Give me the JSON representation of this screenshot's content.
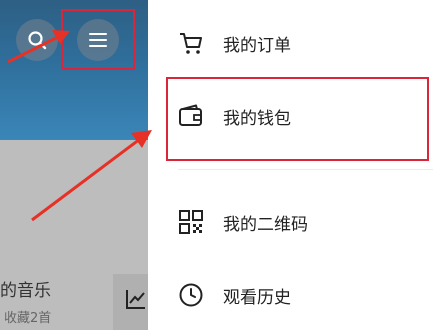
{
  "background_app": {
    "search_button_icon": "search-icon",
    "menu_button_icon": "hamburger-menu-icon",
    "music_title": "的音乐",
    "music_subtitle": "收藏2首",
    "chart_icon": "chart-icon"
  },
  "drawer": {
    "items": [
      {
        "icon": "cart-icon",
        "label": "我的订单"
      },
      {
        "icon": "wallet-icon",
        "label": "我的钱包"
      },
      {
        "icon": "qrcode-icon",
        "label": "我的二维码"
      },
      {
        "icon": "clock-icon",
        "label": "观看历史"
      }
    ]
  },
  "annotations": {
    "highlight_color": "#d9263a"
  }
}
